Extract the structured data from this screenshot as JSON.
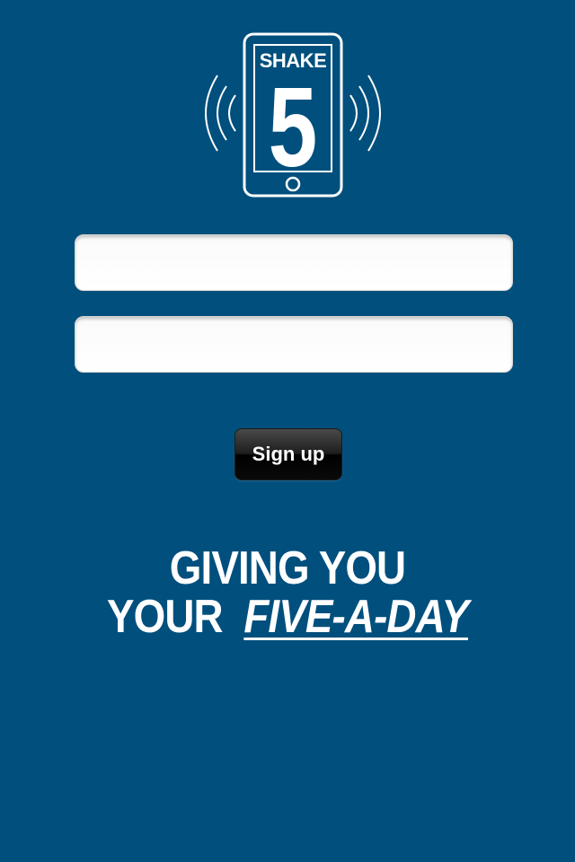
{
  "logo": {
    "word": "SHAKE",
    "number": "5",
    "icon": "shaking-phone-icon"
  },
  "form": {
    "username": {
      "value": "",
      "placeholder": ""
    },
    "password": {
      "value": "",
      "placeholder": ""
    },
    "signup_label": "Sign up"
  },
  "tagline": {
    "line1": "GIVING YOU",
    "line2_prefix": "YOUR",
    "line2_emphasis": "FIVE-A-DAY"
  },
  "colors": {
    "background": "#004f7d",
    "text": "#ffffff"
  }
}
